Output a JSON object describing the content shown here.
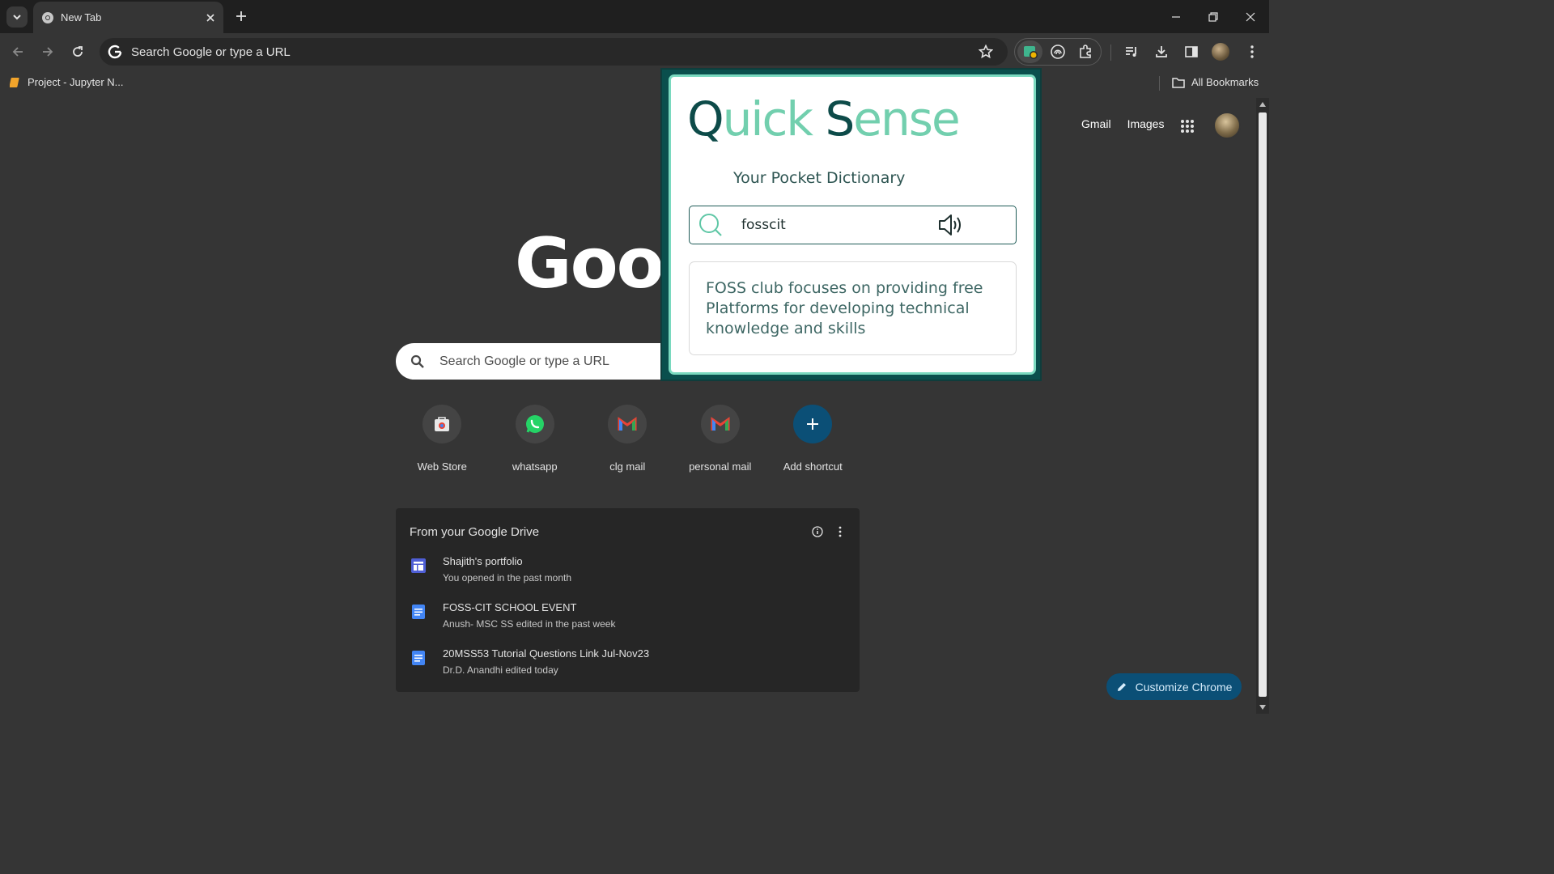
{
  "browser": {
    "tab": {
      "title": "New Tab"
    },
    "omnibox": {
      "placeholder": "Search Google or type a URL"
    },
    "bookmarks": {
      "items": [
        {
          "label": "Project - Jupyter N..."
        }
      ],
      "all_bookmarks_label": "All Bookmarks"
    }
  },
  "newtab": {
    "top_links": {
      "gmail": "Gmail",
      "images": "Images"
    },
    "logo_text": "Goog",
    "search_placeholder": "Search Google or type a URL",
    "shortcuts": [
      {
        "label": "Web Store",
        "icon": "web-store-icon"
      },
      {
        "label": "whatsapp",
        "icon": "whatsapp-icon"
      },
      {
        "label": "clg mail",
        "icon": "gmail-icon"
      },
      {
        "label": "personal mail",
        "icon": "gmail-icon"
      },
      {
        "label": "Add shortcut",
        "icon": "plus-icon"
      }
    ],
    "drive": {
      "title": "From your Google Drive",
      "items": [
        {
          "name": "Shajith's portfolio",
          "sub": "You opened in the past month",
          "icon": "sites-icon"
        },
        {
          "name": "FOSS-CIT SCHOOL EVENT",
          "sub": "Anush- MSC SS edited in the past week",
          "icon": "docs-icon"
        },
        {
          "name": "20MSS53 Tutorial Questions Link Jul-Nov23",
          "sub": "Dr.D. Anandhi edited today",
          "icon": "docs-icon"
        }
      ]
    },
    "customize_label": "Customize Chrome"
  },
  "popup": {
    "title_part1_dark": "Q",
    "title_part1_light": "uick ",
    "title_part2_dark": "S",
    "title_part2_light": "ense",
    "subtitle": "Your Pocket Dictionary",
    "search_value": "fosscit",
    "result": "FOSS club focuses on providing free Platforms for developing technical knowledge and skills"
  },
  "colors": {
    "accent_dark": "#0d4b49",
    "accent_light": "#72cfae",
    "chrome_blue": "#0b4f76"
  }
}
